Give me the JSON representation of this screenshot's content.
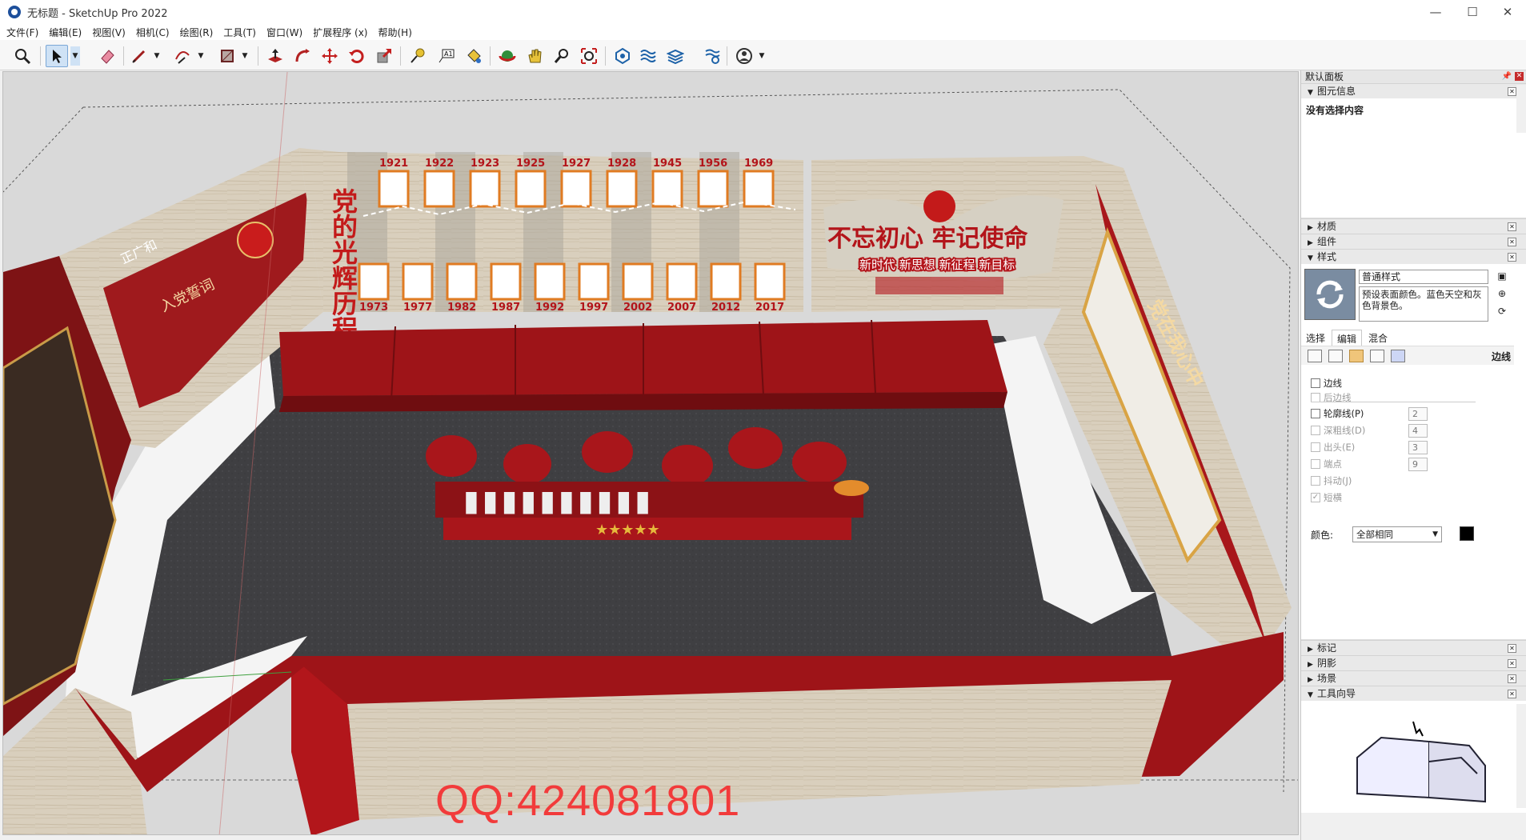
{
  "window": {
    "title": "无标题 - SketchUp Pro 2022",
    "minimize": "—",
    "maximize": "☐",
    "close": "✕"
  },
  "menu": [
    "文件(F)",
    "编辑(E)",
    "视图(V)",
    "相机(C)",
    "绘图(R)",
    "工具(T)",
    "窗口(W)",
    "扩展程序 (x)",
    "帮助(H)"
  ],
  "toolbar": {
    "tools": [
      "zoom-icon",
      "select-icon",
      "eraser-icon",
      "pencil-icon",
      "arc-icon",
      "rectangle-icon",
      "push-pull-icon",
      "follow-me-icon",
      "move-icon",
      "rotate-icon",
      "scale-icon",
      "tape-measure-icon",
      "text-icon",
      "paint-bucket-icon",
      "orbit-icon",
      "pan-icon",
      "zoom-window-icon",
      "zoom-extents-icon",
      "components-icon",
      "sandbox-icon",
      "layers-icon",
      "warehouse-icon",
      "user-icon"
    ]
  },
  "scene": {
    "watermark": "QQ:424081801",
    "colors": {
      "wall_red": "#8e1518",
      "floor": "#3f3f41",
      "wood": "#d6cbb7",
      "bright_red": "#c3171b"
    },
    "wall_years_top": [
      "1921",
      "1922",
      "1923",
      "1925",
      "1927",
      "1928",
      "1945",
      "1956",
      "1969"
    ],
    "wall_years_bottom": [
      "1973",
      "1977",
      "1982",
      "1987",
      "1992",
      "1997",
      "2002",
      "2007",
      "2012",
      "2017"
    ],
    "slogan_main": "不忘初心 牢记使命",
    "slogan_sub": "新时代 新思想 新征程 新目标",
    "left_panel_title": "入党誓词",
    "left_logo": "正广和",
    "vertical_title": "党的光辉历程"
  },
  "tray": {
    "title": "默认面板",
    "entity_info": {
      "header": "图元信息",
      "body": "没有选择内容"
    },
    "collapsed_top": [
      "材质",
      "组件"
    ],
    "styles": {
      "header": "样式",
      "name": "普通样式",
      "description": "预设表面颜色。蓝色天空和灰色背景色。",
      "tabs": [
        "选择",
        "编辑",
        "混合"
      ],
      "edit_label": "边线",
      "options": [
        {
          "label": "边线",
          "checked": false,
          "disabled": false
        },
        {
          "label": "后边线",
          "checked": false,
          "disabled": true
        },
        {
          "label": "轮廓线(P)",
          "checked": false,
          "disabled": false,
          "value": "2"
        },
        {
          "label": "深粗线(D)",
          "checked": false,
          "disabled": true,
          "value": "4"
        },
        {
          "label": "出头(E)",
          "checked": false,
          "disabled": true,
          "value": "3"
        },
        {
          "label": "端点",
          "checked": false,
          "disabled": true,
          "value": "9"
        },
        {
          "label": "抖动(J)",
          "checked": false,
          "disabled": true
        },
        {
          "label": "短横",
          "checked": true,
          "disabled": true
        }
      ],
      "color_label": "颜色:",
      "color_select": "全部相同",
      "color_value": "#000000"
    },
    "collapsed_bottom": [
      "标记",
      "阴影",
      "场景"
    ],
    "tool_guide": {
      "header": "工具向导"
    }
  }
}
